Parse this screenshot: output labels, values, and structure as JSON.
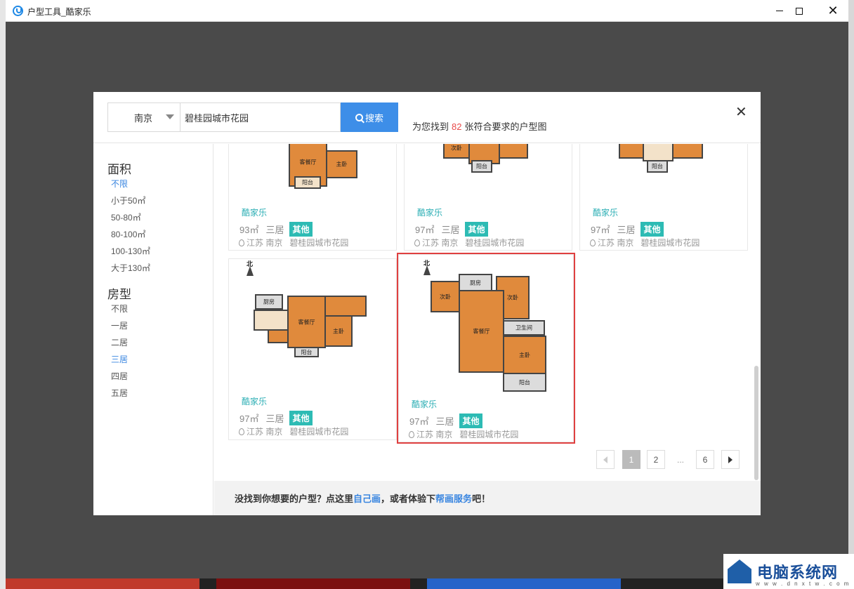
{
  "window": {
    "title": "户型工具_酷家乐",
    "controls": {
      "minimize": "minimize",
      "maximize": "maximize",
      "close": "close"
    }
  },
  "search": {
    "city": "南京",
    "query": "碧桂园城市花园",
    "button_label": "搜索",
    "result_prefix": "为您找到",
    "result_count": "82",
    "result_suffix": "张符合要求的户型图"
  },
  "sidebar": {
    "area_title": "面积",
    "area_options": [
      {
        "label": "不限",
        "active": true
      },
      {
        "label": "小于50㎡",
        "active": false
      },
      {
        "label": "50-80㎡",
        "active": false
      },
      {
        "label": "80-100㎡",
        "active": false
      },
      {
        "label": "100-130㎡",
        "active": false
      },
      {
        "label": "大于130㎡",
        "active": false
      }
    ],
    "type_title": "房型",
    "type_options": [
      {
        "label": "不限",
        "active": false
      },
      {
        "label": "一居",
        "active": false
      },
      {
        "label": "二居",
        "active": false
      },
      {
        "label": "三居",
        "active": true
      },
      {
        "label": "四居",
        "active": false
      },
      {
        "label": "五居",
        "active": false
      }
    ]
  },
  "cards": [
    {
      "brand": "酷家乐",
      "area": "93㎡",
      "rooms": "三居",
      "tag": "其他",
      "province": "江苏",
      "city": "南京",
      "estate": "碧桂园城市花园"
    },
    {
      "brand": "酷家乐",
      "area": "97㎡",
      "rooms": "三居",
      "tag": "其他",
      "province": "江苏",
      "city": "南京",
      "estate": "碧桂园城市花园"
    },
    {
      "brand": "酷家乐",
      "area": "97㎡",
      "rooms": "三居",
      "tag": "其他",
      "province": "江苏",
      "city": "南京",
      "estate": "碧桂园城市花园"
    },
    {
      "brand": "酷家乐",
      "area": "97㎡",
      "rooms": "三居",
      "tag": "其他",
      "province": "江苏",
      "city": "南京",
      "estate": "碧桂园城市花园"
    },
    {
      "brand": "酷家乐",
      "area": "97㎡",
      "rooms": "三居",
      "tag": "其他",
      "province": "江苏",
      "city": "南京",
      "estate": "碧桂园城市花园"
    }
  ],
  "floorplan_labels": {
    "living": "客餐厅",
    "master": "主卧",
    "balcony": "阳台",
    "kitchen": "厨房",
    "bedroom": "次卧",
    "bath": "卫生间",
    "north": "北"
  },
  "pagination": {
    "pages": [
      "1",
      "2",
      "...",
      "6"
    ],
    "current": "1"
  },
  "footer": {
    "text_1": "没找到你想要的户型？点这里",
    "link_1": "自己画",
    "text_2": "，或者体验下",
    "link_2": "帮画服务",
    "text_3": "吧！"
  },
  "watermark": {
    "text": "电脑系统网",
    "sub": "w w w . d n x t w . c o m"
  }
}
